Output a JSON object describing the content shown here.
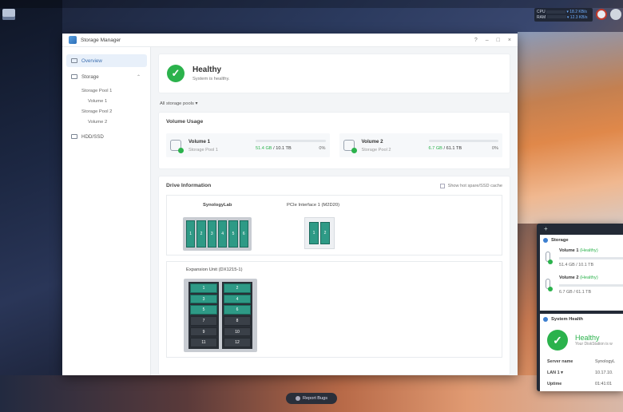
{
  "desktop": {
    "resource_monitor": {
      "cpu_label": "CPU",
      "cpu_value": "▾ 18.2 KB/s",
      "ram_label": "RAM",
      "ram_value": "▾ 12.3 KB/s"
    }
  },
  "window": {
    "title": "Storage Manager",
    "controls": {
      "help": "?",
      "minimize": "–",
      "maximize": "□",
      "close": "×"
    }
  },
  "sidebar": {
    "overview": "Overview",
    "storage": "Storage",
    "storage_pool_1": "Storage Pool 1",
    "volume_1": "Volume 1",
    "storage_pool_2": "Storage Pool 2",
    "volume_2": "Volume 2",
    "hdd_ssd": "HDD/SSD"
  },
  "health": {
    "title": "Healthy",
    "subtitle": "System is healthy."
  },
  "pool_filter": "All storage pools ▾",
  "volume_usage": {
    "heading": "Volume Usage",
    "volumes": [
      {
        "name": "Volume 1",
        "pool": "Storage Pool 1",
        "used": "51.4 GB",
        "total": "/ 10.1 TB",
        "percent": "0%",
        "fill_fraction": 0.005
      },
      {
        "name": "Volume 2",
        "pool": "Storage Pool 2",
        "used": "6.7 GB",
        "total": "/ 61.1 TB",
        "percent": "0%",
        "fill_fraction": 0.001
      }
    ]
  },
  "drive_info": {
    "heading": "Drive Information",
    "hot_spare_label": "Show hot spare/SSD cache",
    "nas_name": "SynologyLab",
    "nas_bays": [
      "1",
      "2",
      "3",
      "4",
      "5",
      "6"
    ],
    "pcie_label": "PCIe Interface 1 (M2D20)",
    "pcie_slots": [
      "1",
      "2"
    ],
    "expansion_label": "Expansion Unit (DX1215-1)",
    "expansion_left": [
      "1",
      "3",
      "5",
      "7",
      "9",
      "11"
    ],
    "expansion_right": [
      "2",
      "4",
      "6",
      "8",
      "10",
      "12"
    ]
  },
  "widget": {
    "plus": "+",
    "storage_title": "Storage",
    "vol1_name": "Volume 1",
    "vol1_status": "(Healthy)",
    "vol1_usage": "51.4 GB / 10.1 TB",
    "vol2_name": "Volume 2",
    "vol2_status": "(Healthy)",
    "vol2_usage": "6.7 GB / 61.1 TB",
    "health_title": "System Health",
    "health_status": "Healthy",
    "health_sub": "Your DiskStation is w",
    "server_name_label": "Server name",
    "server_name_value": "SynologyL",
    "lan_label": "LAN 1 ▾",
    "lan_value": "10.17.10.",
    "uptime_label": "Uptime",
    "uptime_value": "01:41:01"
  },
  "report_bugs": "Report Bugs"
}
